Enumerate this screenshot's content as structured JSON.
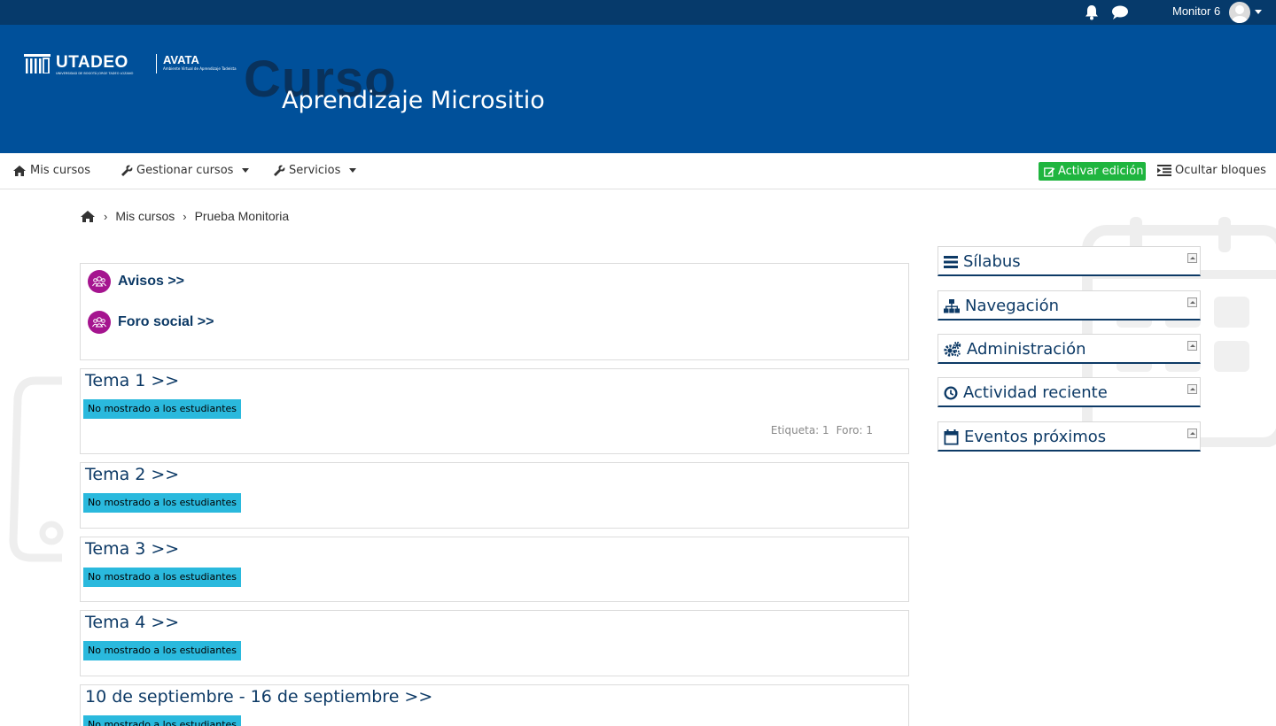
{
  "topbar": {
    "username": "Monitor 6"
  },
  "banner": {
    "logo_name": "UTADEO",
    "logo_sub": "UNIVERSIDAD DE BOGOTÁ JORGE TADEO LOZANO",
    "platform_name": "AVATA",
    "platform_sub": "Ambiente Virtual de Aprendizaje Tadeísta",
    "background_word": "Curso",
    "course_title": "Aprendizaje Micrositio"
  },
  "navbar": {
    "my_courses": "Mis cursos",
    "manage_courses": "Gestionar cursos",
    "services": "Servicios",
    "edit_button": "Activar edición",
    "hide_blocks": "Ocultar bloques"
  },
  "breadcrumb": [
    "Mis cursos",
    "Prueba Monitoria"
  ],
  "general_section": {
    "items": [
      {
        "label": "Avisos >>"
      },
      {
        "label": "Foro social >>"
      }
    ]
  },
  "sections": [
    {
      "title": "Tema 1 >>",
      "badge": "No mostrado a los estudiantes",
      "summary": [
        "Etiqueta: 1",
        "Foro: 1"
      ]
    },
    {
      "title": "Tema 2 >>",
      "badge": "No mostrado a los estudiantes"
    },
    {
      "title": "Tema 3 >>",
      "badge": "No mostrado a los estudiantes"
    },
    {
      "title": "Tema 4 >>",
      "badge": "No mostrado a los estudiantes"
    },
    {
      "title": "10 de septiembre - 16 de septiembre >>",
      "badge": "No mostrado a los estudiantes"
    }
  ],
  "blocks": [
    {
      "title": "Sílabus",
      "icon": "list-icon"
    },
    {
      "title": "Navegación",
      "icon": "sitemap-icon"
    },
    {
      "title": "Administración",
      "icon": "cogs-icon"
    },
    {
      "title": "Actividad reciente",
      "icon": "clock-icon"
    },
    {
      "title": "Eventos próximos",
      "icon": "calendar-icon"
    }
  ],
  "colors": {
    "topbar": "#063a6b",
    "banner": "#00509a",
    "link": "#0d3a66",
    "edit_button": "#1fb53f",
    "badge": "#2ab9dd",
    "forum_icon": "#a5148f"
  }
}
